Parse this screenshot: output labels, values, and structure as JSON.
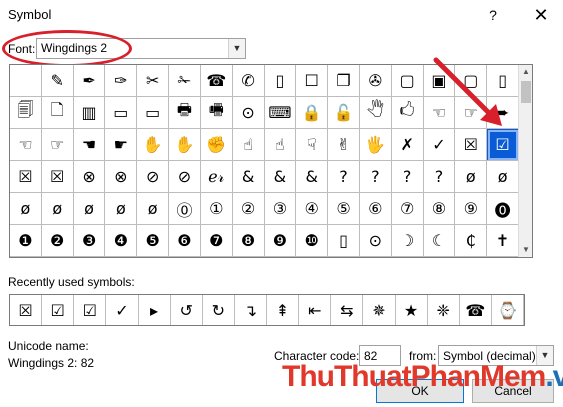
{
  "window": {
    "title": "Symbol",
    "help_label": "?",
    "close_label": "✕"
  },
  "font": {
    "label": "Font:",
    "value": "Wingdings 2"
  },
  "symbol_grid": [
    [
      "",
      "✎",
      "✒",
      "✑",
      "✂",
      "✁",
      "☎",
      "✆",
      "▯",
      "☐",
      "❐",
      "✇",
      "▢",
      "▣",
      "▢",
      "▯"
    ],
    [
      "🗐",
      "🗋",
      "▥",
      "▭",
      "▭",
      "🖶",
      "🖷",
      "⊙",
      "⌨",
      "🔒",
      "🔓",
      "🖑",
      "🖒",
      "☜",
      "☞",
      "➨"
    ],
    [
      "☜",
      "☞",
      "☚",
      "☛",
      "✋",
      "✋",
      "✊",
      "☝",
      "☝",
      "☟",
      "✌",
      "🖐",
      "✗",
      "✓",
      "☒",
      "☑"
    ],
    [
      "☒",
      "☒",
      "⊗",
      "⊗",
      "⊘",
      "⊘",
      "ℯ𝓇",
      "&",
      "&",
      "&",
      "?",
      "?",
      "?",
      "?",
      "ø",
      "ø"
    ],
    [
      "ø",
      "ø",
      "ø",
      "ø",
      "ø",
      "⓪",
      "①",
      "②",
      "③",
      "④",
      "⑤",
      "⑥",
      "⑦",
      "⑧",
      "⑨",
      "⓿"
    ],
    [
      "❶",
      "❷",
      "❸",
      "❹",
      "❺",
      "❻",
      "❼",
      "❽",
      "❾",
      "❿",
      "▯",
      "⊙",
      "☽",
      "☾",
      "₵",
      "✝"
    ]
  ],
  "recent": {
    "label": "Recently used symbols:",
    "items": [
      "☒",
      "☑",
      "☑",
      "✓",
      "▸",
      "↺",
      "↻",
      "↴",
      "⇞",
      "⇤",
      "⇆",
      "✵",
      "★",
      "❈",
      "☎",
      "⌚",
      "➾"
    ]
  },
  "unicode": {
    "label": "Unicode name:",
    "value": "Wingdings 2: 82"
  },
  "character_code": {
    "label": "Character code:",
    "value": "82"
  },
  "from": {
    "label": "from:",
    "value": "Symbol (decimal)"
  },
  "buttons": {
    "ok": "OK",
    "cancel": "Cancel"
  },
  "watermark": {
    "part1": "ThuThuat",
    "part2": "PhanMem",
    "part3": ".vn"
  },
  "colors": {
    "annotation_red": "#d7202b",
    "selected_blue": "#0a5cd6"
  }
}
